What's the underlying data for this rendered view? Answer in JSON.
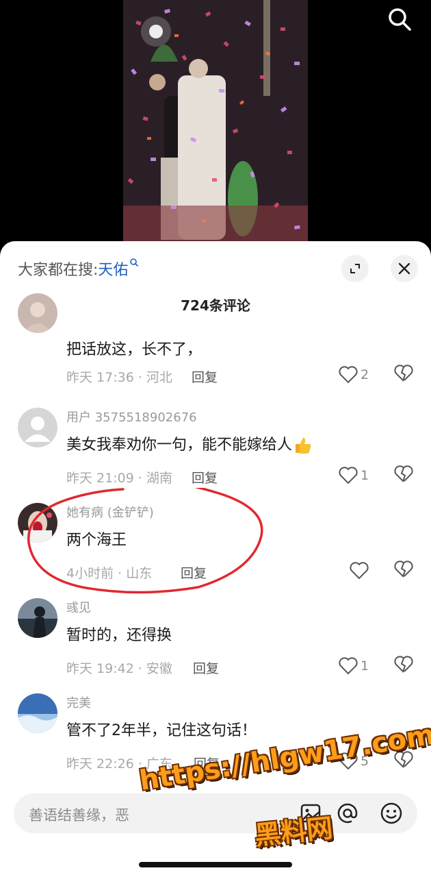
{
  "sheet": {
    "search_prefix": "大家都在搜:",
    "search_keyword": "天佑",
    "count_title": "724条评论"
  },
  "comments": [
    {
      "user": "",
      "text": "把话放这，长不了，",
      "time": "昨天 17:36 · 河北",
      "reply": "回复",
      "likes": "2"
    },
    {
      "user": "用户 3575518902676",
      "text": "美女我奉劝你一句，能不能嫁给人",
      "time": "昨天 21:09 · 湖南",
      "reply": "回复",
      "likes": "1"
    },
    {
      "user": "她有病 (金铲铲)",
      "text": "两个海王",
      "time": "4小时前 · 山东",
      "reply": "回复",
      "likes": ""
    },
    {
      "user": "彧见",
      "text": "暂时的，还得换",
      "time": "昨天 19:42 · 安徽",
      "reply": "回复",
      "likes": "1"
    },
    {
      "user": "完美",
      "text": "管不了2年半，记住这句话！",
      "time": "昨天 22:26 · 广东",
      "reply": "回复",
      "likes": "5"
    }
  ],
  "input": {
    "placeholder": "善语结善缘，恶"
  },
  "watermark": {
    "url": "https://hlgw17.com",
    "name": "黑料网"
  },
  "colors": {
    "keyword": "#1d5fbf",
    "annotation": "#e0282f",
    "watermark": "#ff9d1a"
  }
}
